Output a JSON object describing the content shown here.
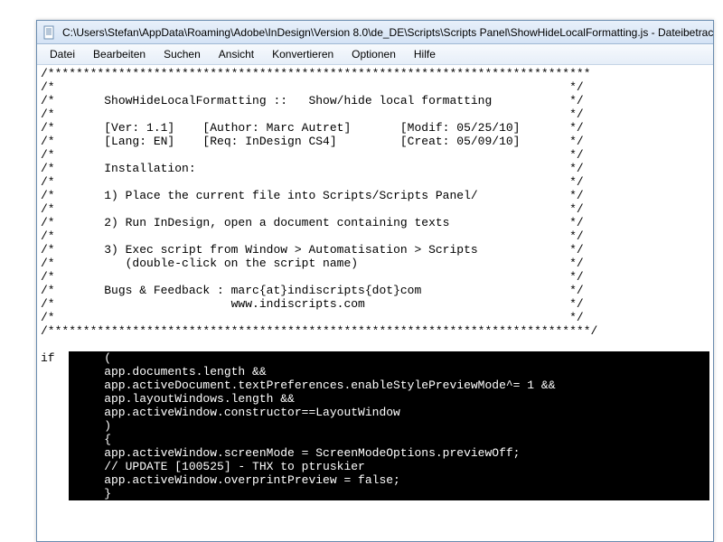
{
  "title": "C:\\Users\\Stefan\\AppData\\Roaming\\Adobe\\InDesign\\Version 8.0\\de_DE\\Scripts\\Scripts Panel\\ShowHideLocalFormatting.js - Dateibetrachte",
  "menu": {
    "datei": "Datei",
    "bearbeiten": "Bearbeiten",
    "suchen": "Suchen",
    "ansicht": "Ansicht",
    "konvertieren": "Konvertieren",
    "optionen": "Optionen",
    "hilfe": "Hilfe"
  },
  "header": {
    "l01": "/*****************************************************************************",
    "l02": "/*                                                                         */",
    "l03": "/*       ShowHideLocalFormatting ::   Show/hide local formatting           */",
    "l04": "/*                                                                         */",
    "l05": "/*       [Ver: 1.1]    [Author: Marc Autret]       [Modif: 05/25/10]       */",
    "l06": "/*       [Lang: EN]    [Req: InDesign CS4]         [Creat: 05/09/10]       */",
    "l07": "/*                                                                         */",
    "l08": "/*       Installation:                                                     */",
    "l09": "/*                                                                         */",
    "l10": "/*       1) Place the current file into Scripts/Scripts Panel/             */",
    "l11": "/*                                                                         */",
    "l12": "/*       2) Run InDesign, open a document containing texts                 */",
    "l13": "/*                                                                         */",
    "l14": "/*       3) Exec script from Window > Automatisation > Scripts             */",
    "l15": "/*          (double-click on the script name)                              */",
    "l16": "/*                                                                         */",
    "l17": "/*       Bugs & Feedback : marc{at}indiscripts{dot}com                     */",
    "l18": "/*                         www.indiscripts.com                             */",
    "l19": "/*                                                                         */",
    "l20": "/*****************************************************************************/",
    "l21": ""
  },
  "sel": {
    "kw": "if",
    "b01": "     (",
    "b02": "     app.documents.length &&",
    "b03": "     app.activeDocument.textPreferences.enableStylePreviewMode^= 1 &&",
    "b04": "     app.layoutWindows.length &&",
    "b05": "     app.activeWindow.constructor==LayoutWindow",
    "b06": "     )",
    "b07": "     {",
    "b08": "     app.activeWindow.screenMode = ScreenModeOptions.previewOff;",
    "b09": "     // UPDATE [100525] - THX to ptruskier",
    "b10": "     app.activeWindow.overprintPreview = false;",
    "b11": "     }"
  }
}
